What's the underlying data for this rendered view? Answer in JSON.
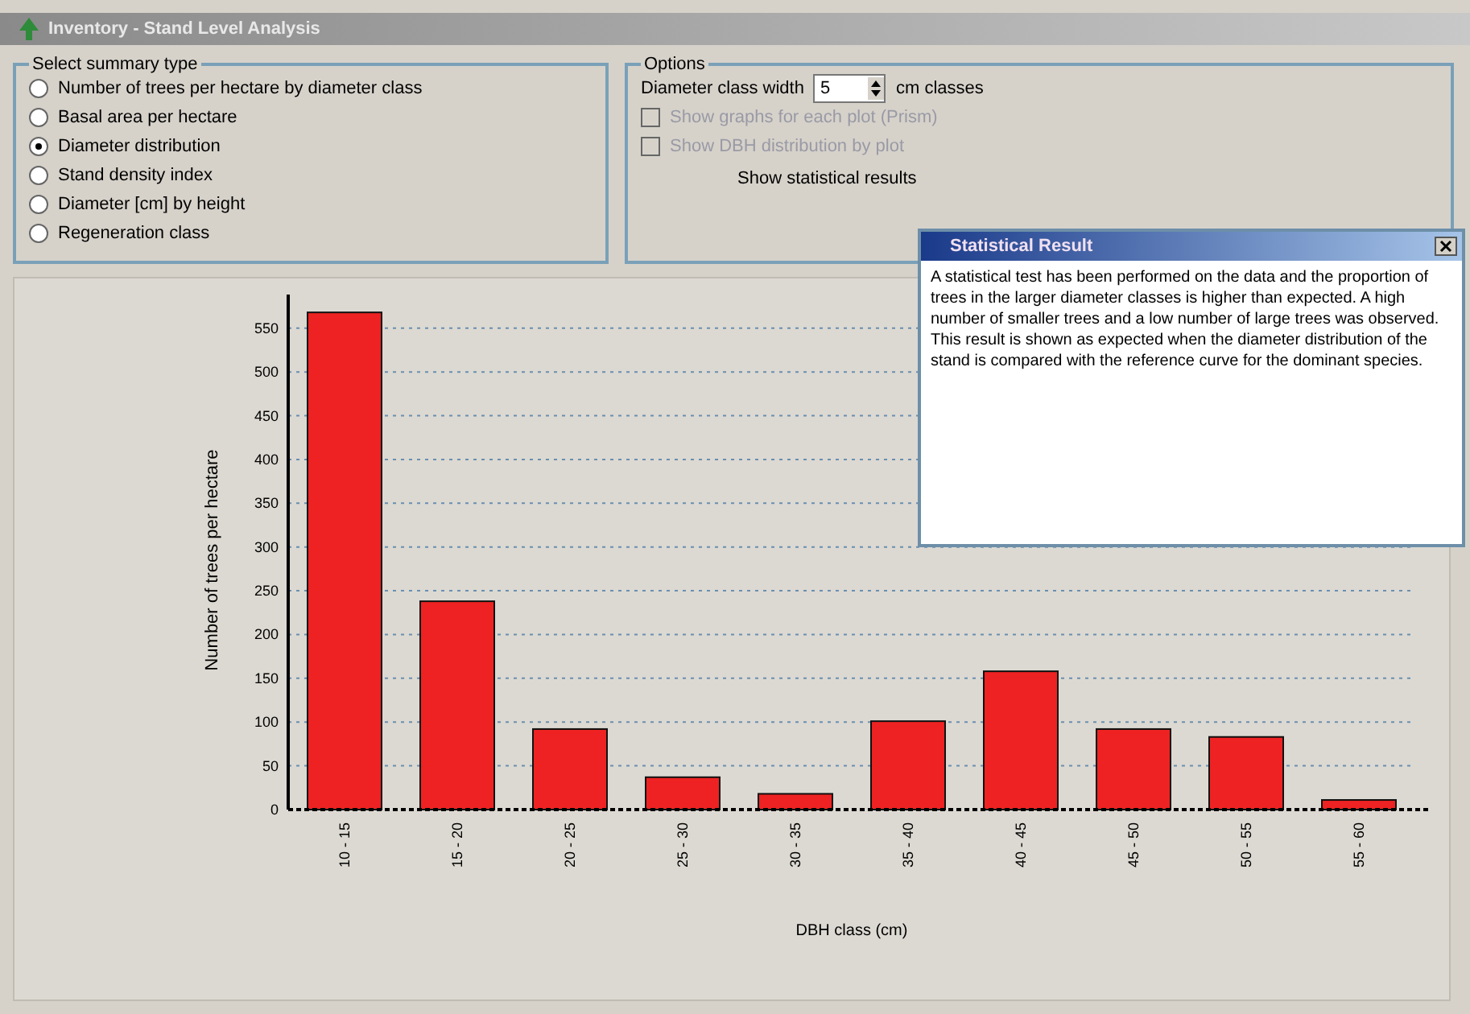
{
  "window": {
    "title": "Inventory - Stand Level Analysis"
  },
  "summary_type": {
    "title": "Select summary type",
    "options": [
      {
        "label": "Number of trees per hectare by diameter class",
        "selected": false
      },
      {
        "label": "Basal area per hectare",
        "selected": false
      },
      {
        "label": "Diameter distribution",
        "selected": true
      },
      {
        "label": "Stand density index",
        "selected": false
      },
      {
        "label": "Diameter [cm] by height",
        "selected": false
      },
      {
        "label": "Regeneration class",
        "selected": false
      }
    ]
  },
  "options": {
    "title": "Options",
    "class_width_label": "Diameter class width",
    "class_width_value": "5",
    "unit_label": "cm classes",
    "checkboxes": [
      {
        "label": "Show graphs for each plot (Prism)",
        "checked": false,
        "disabled": true
      },
      {
        "label": "Show DBH distribution by plot",
        "checked": false,
        "disabled": true
      }
    ],
    "results_label": "Show statistical results"
  },
  "popup": {
    "title": "Statistical Result",
    "text": "A statistical test has been performed on the data and the proportion of trees in the larger diameter classes is higher than expected. A high number of smaller trees and a low number of large trees was observed. This result is shown as expected when the diameter distribution of the stand is compared with the reference curve for the dominant species."
  },
  "chart_data": {
    "type": "bar",
    "ylabel": "Number of trees per hectare",
    "xlabel": "DBH class (cm)",
    "categories": [
      "10 - 15",
      "15 - 20",
      "20 - 25",
      "25 - 30",
      "30 - 35",
      "35 - 40",
      "40 - 45",
      "45 - 50",
      "50 - 55",
      "55 - 60"
    ],
    "grid": true,
    "series": [
      {
        "color": "#ee2222",
        "values": [
          568,
          238,
          92,
          37,
          18,
          101,
          158,
          92,
          83,
          11
        ]
      }
    ],
    "ylim": [
      0,
      570
    ],
    "yticks": [
      0,
      50,
      100,
      150,
      200,
      250,
      300,
      350,
      400,
      450,
      500,
      550
    ]
  }
}
